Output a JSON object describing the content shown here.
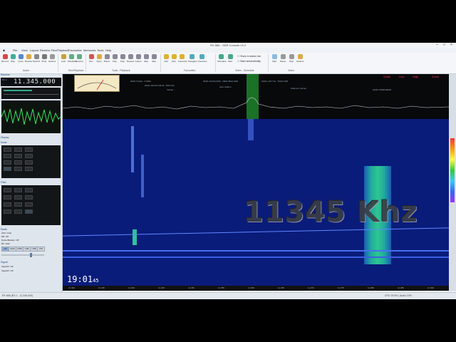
{
  "window": {
    "title": "RX 666 - SDR Console v3.4",
    "controls": [
      "–",
      "□",
      "×"
    ]
  },
  "menu": [
    "File",
    "View",
    "Layout",
    "Receive",
    "Rec/Playback",
    "Favourites",
    "Memories",
    "Tools",
    "Help"
  ],
  "ribbon": {
    "groups": [
      {
        "title": "Audio",
        "buttons": [
          "Record",
          "Play",
          "Cycle",
          "Browse",
          "Restrict",
          "Mute",
          "Options"
        ]
      },
      {
        "title": "Rec/Playback",
        "buttons": [
          "Lock",
          "Playback",
          "Receive",
          "Zoom",
          "Browse"
        ]
      },
      {
        "title": "Tools - Playback",
        "buttons": [
          "Rec",
          "Open",
          "Pause",
          "Play",
          "Stop",
          "Repeat",
          "Output",
          "Skip",
          "Skip"
        ]
      },
      {
        "title": "Favourites",
        "buttons": [
          "Add",
          "Edit",
          "Favourite",
          "Navigator",
          "Favorites"
        ]
      },
      {
        "title": "Video - Schedule",
        "buttons": [
          "Schedule",
          "Start",
          "Show in status bar",
          "Start automatically"
        ]
      },
      {
        "title": "Video",
        "buttons": [
          "Start",
          "Pause",
          "Stop",
          "Options"
        ]
      }
    ],
    "show_in_status_bar": "Show in status bar",
    "start_automatically": "Start automatically"
  },
  "left_panel": {
    "rx_label": "RX 1",
    "frequency": "11.345.000",
    "sections": [
      "Receive",
      "Display",
      "Mode",
      "Filter",
      "Radio",
      "Signal"
    ],
    "mode_buttons": [
      "AM",
      "SAM",
      "DSB",
      "LSB",
      "USB",
      "CW"
    ],
    "selected_mode": "AM",
    "radio_items": [
      "AGC: Fast",
      "NR: Off",
      "Noise Blanker: Off",
      "RF: Gain"
    ],
    "signal_items": [
      "Squelch: Off",
      "Squelch: Off"
    ]
  },
  "spectrum": {
    "buttons": [
      "Scale",
      "Low",
      "High",
      "Zoom"
    ],
    "station_labels": [
      "HFDL KOHA - CHINA",
      "HFDL SANTA CRUZ - BOLIVIA",
      "Volmet ...",
      "HFDL AUCKLAND - NEW ZEALAND",
      "Aero Station",
      "HFDL HAT YAI - THAILAND",
      "HFDL RIVERHEAD",
      "Shannon Volmet"
    ],
    "db_labels": [
      "-30",
      "-40",
      "-50",
      "-60",
      "-70",
      "-80",
      "-90",
      "-100",
      "-110"
    ]
  },
  "waterfall": {
    "overlay_freq": "11345 Khz",
    "clock": "19:01",
    "clock_seconds": "45",
    "freq_ticks": [
      "11.330",
      "11.335",
      "11.340",
      "11.345",
      "11.350",
      "11.355",
      "11.360",
      "11.365",
      "11.370",
      "11.375",
      "11.380",
      "11.385",
      "11.390"
    ]
  },
  "status_bar": {
    "left": "RX 666 (RX 1 - 11.345.000)",
    "right": "CPU 19.5%  |  Audio 22%"
  },
  "colors": {
    "waterfall_bg": "#0a1c7a",
    "accent": "#2d7fd0",
    "spectrum_bg": "#07090b",
    "signal_green": "#1fd070"
  }
}
